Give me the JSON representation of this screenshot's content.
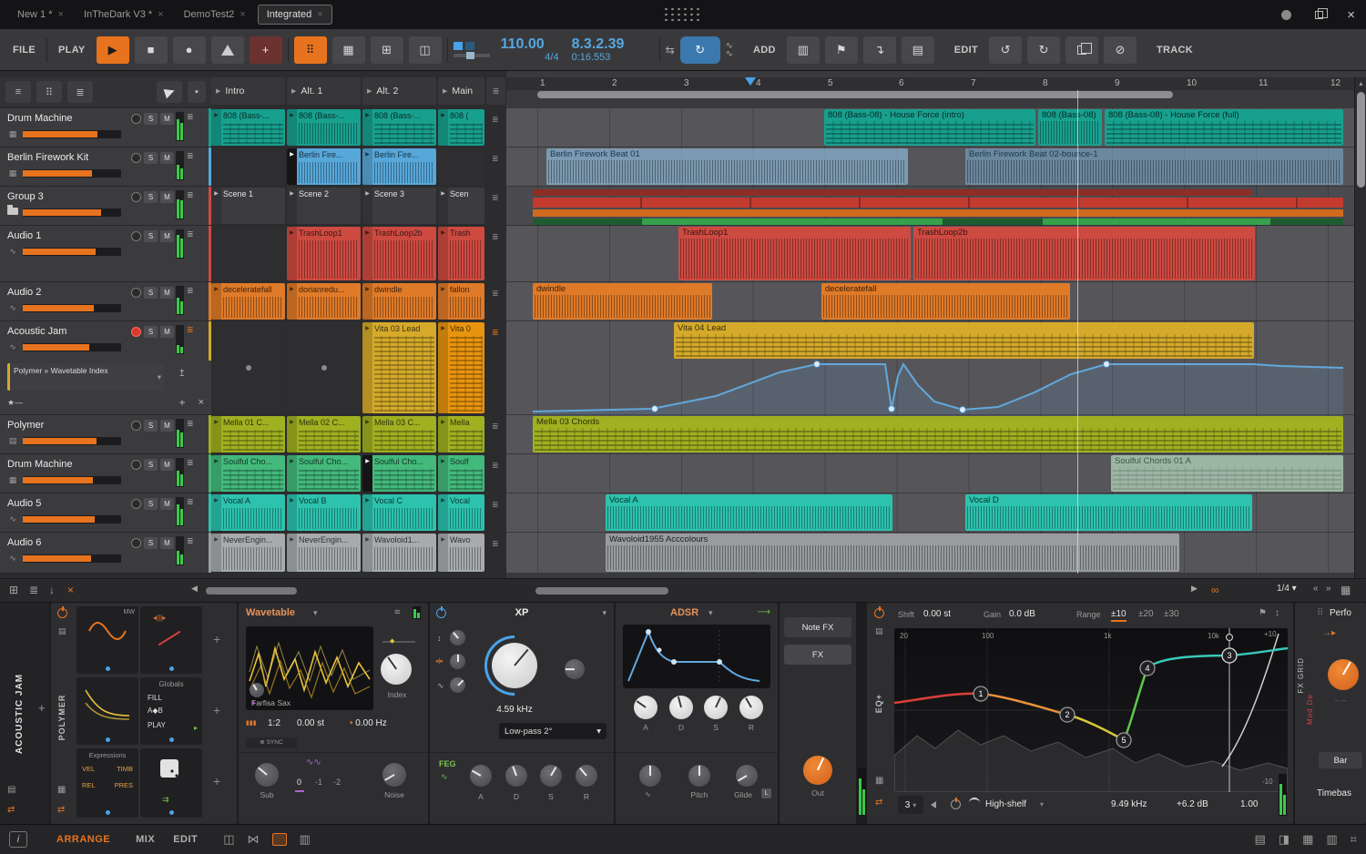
{
  "palette": {
    "accent": "#e8731e",
    "blue": "#55a8e0",
    "teal": "#18a08e",
    "sky": "#57a7d9",
    "red": "#cd4a41",
    "orange": "#df7a28",
    "yellow": "#d5aa2a",
    "lime": "#9fb021",
    "green": "#43b97c",
    "cyan": "#2cc2ae",
    "gray": "#9aa0a2"
  },
  "icons": {
    "play": "▶",
    "stop": "■",
    "record": "●",
    "close": "×",
    "menu": "≣",
    "caret": "▾"
  },
  "titlebar": {
    "tabs": [
      {
        "label": "New 1 *"
      },
      {
        "label": "InTheDark V3 *"
      },
      {
        "label": "DemoTest2"
      },
      {
        "label": "Integrated"
      }
    ]
  },
  "transport": {
    "file": "FILE",
    "play": "PLAY",
    "add": "ADD",
    "edit": "EDIT",
    "track": "TRACK",
    "tempo": "110.00",
    "signature": "4/4",
    "position": "8.3.2.39",
    "time": "0:16.553"
  },
  "labels": {
    "solo": "S",
    "mute": "M"
  },
  "scenes": [
    {
      "name": "Intro"
    },
    {
      "name": "Alt. 1"
    },
    {
      "name": "Alt. 2"
    },
    {
      "name": "Main"
    }
  ],
  "tracks": [
    {
      "name": "Drum Machine"
    },
    {
      "name": "Berlin Firework Kit"
    },
    {
      "name": "Group 3"
    },
    {
      "name": "Audio 1"
    },
    {
      "name": "Audio 2"
    },
    {
      "name": "Acoustic Jam",
      "device_chip": "Polymer » Wavetable Index"
    },
    {
      "name": "Polymer"
    },
    {
      "name": "Drum Machine"
    },
    {
      "name": "Audio 5"
    },
    {
      "name": "Audio 6"
    }
  ],
  "launcher": {
    "rows": [
      [
        "808 (Bass-...",
        "808 (Bass-...",
        "808 (Bass-...",
        "808 ("
      ],
      [
        "",
        "Berlin Fire...",
        "Berlin Fire...",
        ""
      ],
      [
        "Scene 1",
        "Scene 2",
        "Scene 3",
        "Scen"
      ],
      [
        "",
        "TrashLoop1",
        "TrashLoop2b",
        "Trash"
      ],
      [
        "deceleratefall",
        "dorianredu...",
        "dwindle",
        "fallon"
      ],
      [
        "",
        "",
        "Vita 03 Lead",
        "Vita 0"
      ],
      [
        "Mella 01 C...",
        "Mella 02 C...",
        "Mella 03 C...",
        "Mella"
      ],
      [
        "Soulful Cho...",
        "Soulful Cho...",
        "Soulful Cho...",
        "Soulf"
      ],
      [
        "Vocal A",
        "Vocal B",
        "Vocal C",
        "Vocal"
      ],
      [
        "NeverEngin...",
        "NeverEngin...",
        "Wavoloid1...",
        "Wavo"
      ]
    ]
  },
  "arranger": {
    "ruler": [
      "1",
      "2",
      "3",
      "4",
      "5",
      "6",
      "7",
      "8",
      "9",
      "10",
      "11",
      "12"
    ],
    "grid": "1/4",
    "clips": {
      "bass_intro": "808 (Bass-08) - House Force (intro)",
      "bass_mid": "808 (Bass-08)",
      "bass_full": "808 (Bass-08) - House Force (full)",
      "berlin1": "Berlin Firework Beat 01",
      "berlin2": "Berlin Firework Beat 02-bounce-1",
      "trash1": "TrashLoop1",
      "trash2": "TrashLoop2b",
      "dwindle": "dwindle",
      "decel": "deceleratefall",
      "vita": "Vita 04 Lead",
      "mella": "Mella 03 Chords",
      "soulful": "Soulful Chords 01 A",
      "vocal_a": "Vocal A",
      "vocal_d": "Vocal D",
      "wavoloid": "Wavoloid1955 Acccolours"
    }
  },
  "device": {
    "track_label": "ACOUSTIC JAM",
    "polymer": {
      "name": "POLYMER",
      "mw": "MW",
      "globals_title": "Globals",
      "fill": "FILL",
      "ab": "A◆B",
      "play": "PLAY",
      "expressions_title": "Expressions",
      "vel": "VEL",
      "timb": "TIMB",
      "rel": "REL",
      "pres": "PRES"
    },
    "wavetable": {
      "title": "Wavetable",
      "preset": "Farfisa Sax",
      "index": "Index",
      "ratio": "1:2",
      "detune": "0.00 st",
      "freq": "0.00 Hz",
      "sync": "SYNC",
      "sub": "Sub",
      "scale": [
        "0",
        "-1",
        "-2"
      ],
      "noise": "Noise"
    },
    "filter": {
      "title": "XP",
      "cutoff": "4.59 kHz",
      "mode": "Low-pass 2°",
      "feg": "FEG",
      "a": "A",
      "d": "D",
      "s": "S",
      "r": "R"
    },
    "env": {
      "title": "ADSR",
      "a": "A",
      "d": "D",
      "s": "S",
      "r": "R",
      "pitch": "Pitch",
      "glide": "Glide",
      "glide_badge": "L"
    },
    "fx": {
      "note_fx": "Note FX",
      "fx": "FX",
      "out": "Out"
    },
    "eq": {
      "label": "EQ+",
      "shift_label": "Shift",
      "shift": "0.00 st",
      "gain_label": "Gain",
      "gain": "0.0 dB",
      "range_label": "Range",
      "r10": "±10",
      "r20": "±20",
      "r30": "±30",
      "f20": "20",
      "f100": "100",
      "f1k": "1k",
      "f10k": "10k",
      "dbp": "+10",
      "dbm": "-10",
      "band_count": "3",
      "band_type": "High-shelf",
      "band_freq": "9.49 kHz",
      "band_gain": "+6.2 dB",
      "band_q": "1.00",
      "p1": "1",
      "p2": "2",
      "p3": "3",
      "p4": "4",
      "p5": "5"
    },
    "right": {
      "fx_grid": "FX GRID",
      "mod": "Mod De",
      "perf": "Perfo",
      "bar": "Bar",
      "timebase": "Timebas"
    }
  },
  "statusbar": {
    "arrange": "ARRANGE",
    "mix": "MIX",
    "edit": "EDIT"
  }
}
